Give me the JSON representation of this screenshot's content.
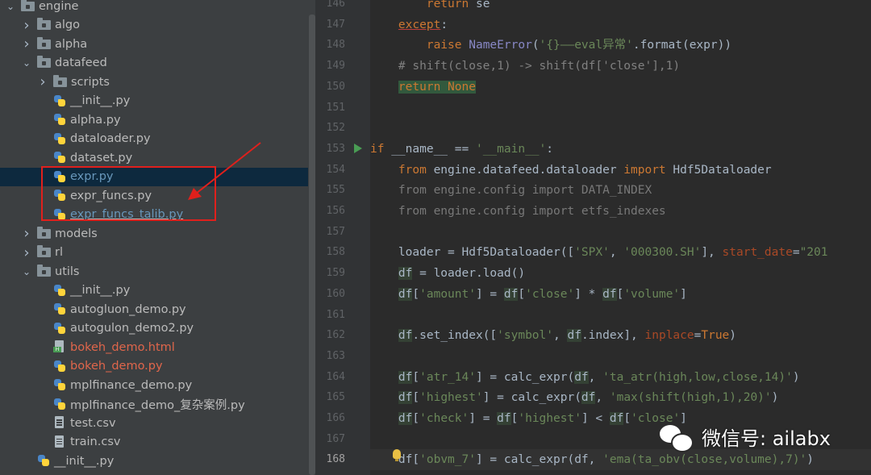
{
  "tree": {
    "items": [
      {
        "label": "engine",
        "type": "folder",
        "depth": 0,
        "expanded": true
      },
      {
        "label": "algo",
        "type": "folder",
        "depth": 1,
        "expanded": false
      },
      {
        "label": "alpha",
        "type": "folder",
        "depth": 1,
        "expanded": false
      },
      {
        "label": "datafeed",
        "type": "folder",
        "depth": 1,
        "expanded": true
      },
      {
        "label": "scripts",
        "type": "folder",
        "depth": 2,
        "expanded": false
      },
      {
        "label": "__init__.py",
        "type": "py",
        "depth": 2
      },
      {
        "label": "alpha.py",
        "type": "py",
        "depth": 2
      },
      {
        "label": "dataloader.py",
        "type": "py",
        "depth": 2
      },
      {
        "label": "dataset.py",
        "type": "py",
        "depth": 2
      },
      {
        "label": "expr.py",
        "type": "py",
        "depth": 2,
        "selected": true,
        "color": "blue"
      },
      {
        "label": "expr_funcs.py",
        "type": "py",
        "depth": 2
      },
      {
        "label": "expr_funcs_talib.py",
        "type": "py",
        "depth": 2,
        "color": "blue"
      },
      {
        "label": "models",
        "type": "folder",
        "depth": 1,
        "expanded": false
      },
      {
        "label": "rl",
        "type": "folder",
        "depth": 1,
        "expanded": false
      },
      {
        "label": "utils",
        "type": "folder",
        "depth": 1,
        "expanded": true
      },
      {
        "label": "__init__.py",
        "type": "py",
        "depth": 2
      },
      {
        "label": "autogluon_demo.py",
        "type": "py",
        "depth": 2
      },
      {
        "label": "autogulon_demo2.py",
        "type": "py",
        "depth": 2
      },
      {
        "label": "bokeh_demo.html",
        "type": "html",
        "depth": 2,
        "color": "red"
      },
      {
        "label": "bokeh_demo.py",
        "type": "py",
        "depth": 2,
        "color": "red"
      },
      {
        "label": "mplfinance_demo.py",
        "type": "py",
        "depth": 2
      },
      {
        "label": "mplfinance_demo_复杂案例.py",
        "type": "py",
        "depth": 2
      },
      {
        "label": "test.csv",
        "type": "csv",
        "depth": 2
      },
      {
        "label": "train.csv",
        "type": "csv",
        "depth": 2
      },
      {
        "label": "__init__.py",
        "type": "py",
        "depth": 1
      }
    ]
  },
  "editor": {
    "line_numbers": [
      "146",
      "147",
      "148",
      "149",
      "150",
      "151",
      "152",
      "153",
      "154",
      "155",
      "156",
      "157",
      "158",
      "159",
      "160",
      "161",
      "162",
      "163",
      "164",
      "165",
      "166",
      "167",
      "168"
    ],
    "current_line": "168",
    "code": {
      "l146": {
        "kw": "return",
        "rest": " se"
      },
      "l147": {
        "kw": "except",
        "rest": ":"
      },
      "l148": {
        "kw": "raise",
        "fn": "NameError",
        "p1": "(",
        "s1": "'{}——eval异常'",
        "p2": ".format(expr))"
      },
      "l149": {
        "cmt": "# shift(close,1) -> shift(df['close'],1)"
      },
      "l150": {
        "kw1": "return",
        "kw2": "None"
      },
      "l153": {
        "kw": "if",
        "p1": " __name__ == ",
        "s1": "'__main__'",
        "p2": ":"
      },
      "l154": {
        "kw1": "from",
        "m": " engine.datafeed.dataloader ",
        "kw2": "import",
        "c": " Hdf5Dataloader"
      },
      "l155": {
        "text": "from engine.config import DATA_INDEX"
      },
      "l156": {
        "text": "from engine.config import etfs_indexes"
      },
      "l158": {
        "a": "loader = Hdf5Dataloader([",
        "s1": "'SPX'",
        "b": ", ",
        "s2": "'000300.SH'",
        "c": "], ",
        "k": "start_date",
        "d": "=",
        "s3": "\"201"
      },
      "l159": {
        "v": "df",
        "a": " = loader.load()"
      },
      "l160": {
        "v1": "df",
        "s1": "'amount'",
        "v2": "df",
        "s2": "'close'",
        "v3": "df",
        "s3": "'volume'"
      },
      "l162": {
        "v": "df",
        "a": ".set_index([",
        "s1": "'symbol'",
        "b": ", ",
        "v2": "df",
        "c": ".index], ",
        "k": "inplace",
        "d": "=",
        "t": "True",
        "e": ")"
      },
      "l164": {
        "v": "df",
        "s1": "'atr_14'",
        "a": "] = calc_expr(",
        "v2": "df",
        "b": ", ",
        "s2": "'ta_atr(high,low,close,14)'",
        "c": ")"
      },
      "l165": {
        "v": "df",
        "s1": "'highest'",
        "a": "] = calc_expr(",
        "v2": "df",
        "b": ", ",
        "s2": "'max(shift(high,1),20)'",
        "c": ")"
      },
      "l166": {
        "v": "df",
        "s1": "'check'",
        "a": "] = ",
        "v2": "df",
        "s2": "'highest'",
        "b": "] < ",
        "v3": "df",
        "s3": "'close'",
        "c": "]"
      },
      "l168": {
        "v": "df",
        "s1": "'obvm_7'",
        "a": "] = calc_expr(",
        "v2": "df",
        "b": ", ",
        "s2": "'ema(ta_obv(close,volume),7)'",
        "c": ")"
      }
    }
  },
  "watermark": {
    "text": "微信号: ailabx"
  },
  "colors": {
    "highlight_box": "#e0201c",
    "selection": "#214283"
  }
}
